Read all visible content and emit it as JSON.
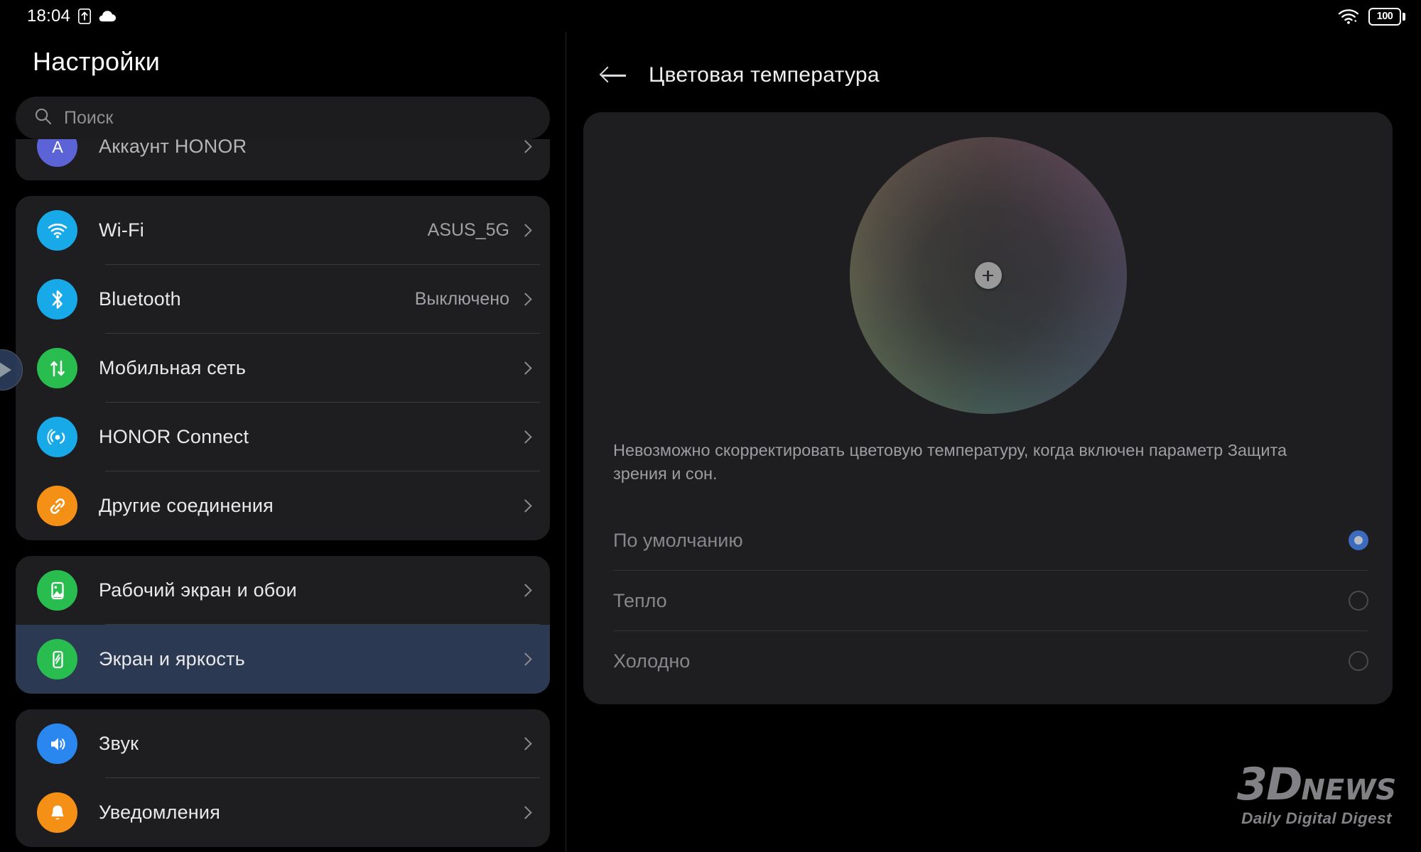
{
  "status_bar": {
    "clock": "18:04",
    "icons_left": [
      "upload-indicator-icon",
      "cloud-icon"
    ],
    "icons_right": [
      "wifi-icon",
      "battery-icon"
    ],
    "battery_level": "100"
  },
  "sidebar": {
    "title": "Настройки",
    "search": {
      "placeholder": "Поиск",
      "value": "",
      "icon": "search-icon"
    },
    "edge_handle_icon": "play-arrow-icon",
    "groups": [
      {
        "id": "account",
        "items": [
          {
            "label": "Аккаунт HONOR",
            "value": "",
            "icon": "avatar-icon",
            "icon_color": "#5b63d6",
            "selected": false
          }
        ]
      },
      {
        "id": "connectivity",
        "items": [
          {
            "label": "Wi-Fi",
            "value": "ASUS_5G",
            "icon": "wifi-icon",
            "icon_color": "#17a9e8",
            "selected": false
          },
          {
            "label": "Bluetooth",
            "value": "Выключено",
            "icon": "bluetooth-icon",
            "icon_color": "#17a9e8",
            "selected": false
          },
          {
            "label": "Мобильная сеть",
            "value": "",
            "icon": "mobile-network-icon",
            "icon_color": "#28bd4e",
            "selected": false
          },
          {
            "label": "HONOR Connect",
            "value": "",
            "icon": "honor-connect-icon",
            "icon_color": "#17a9e8",
            "selected": false
          },
          {
            "label": "Другие соединения",
            "value": "",
            "icon": "link-icon",
            "icon_color": "#f39015",
            "selected": false
          }
        ]
      },
      {
        "id": "display",
        "items": [
          {
            "label": "Рабочий экран и обои",
            "value": "",
            "icon": "wallpaper-icon",
            "icon_color": "#28bd4e",
            "selected": false
          },
          {
            "label": "Экран и яркость",
            "value": "",
            "icon": "brightness-icon",
            "icon_color": "#28bd4e",
            "selected": true
          }
        ]
      },
      {
        "id": "sound",
        "items": [
          {
            "label": "Звук",
            "value": "",
            "icon": "volume-icon",
            "icon_color": "#2b87f0",
            "selected": false
          },
          {
            "label": "Уведомления",
            "value": "",
            "icon": "bell-icon",
            "icon_color": "#f39015",
            "selected": false
          }
        ]
      }
    ]
  },
  "main": {
    "back_icon": "back-arrow-icon",
    "title": "Цветовая температура",
    "color_wheel": {
      "handle_icon": "plus-crosshair-icon",
      "enabled": false
    },
    "warning": "Невозможно скорректировать цветовую температуру, когда включен параметр Защита зрения и сон.",
    "options": [
      {
        "label": "По умолчанию",
        "checked": true
      },
      {
        "label": "Тепло",
        "checked": false
      },
      {
        "label": "Холодно",
        "checked": false
      }
    ]
  },
  "watermark": {
    "logo": "3D",
    "logo_suffix": "NEWS",
    "tagline": "Daily Digital Digest"
  },
  "colors": {
    "background": "#000000",
    "card": "#1e1e20",
    "selected_row": "#2b3953",
    "accent_blue": "#3b6bbf",
    "text_primary": "#e9e9ec",
    "text_secondary": "#9d9da2"
  }
}
